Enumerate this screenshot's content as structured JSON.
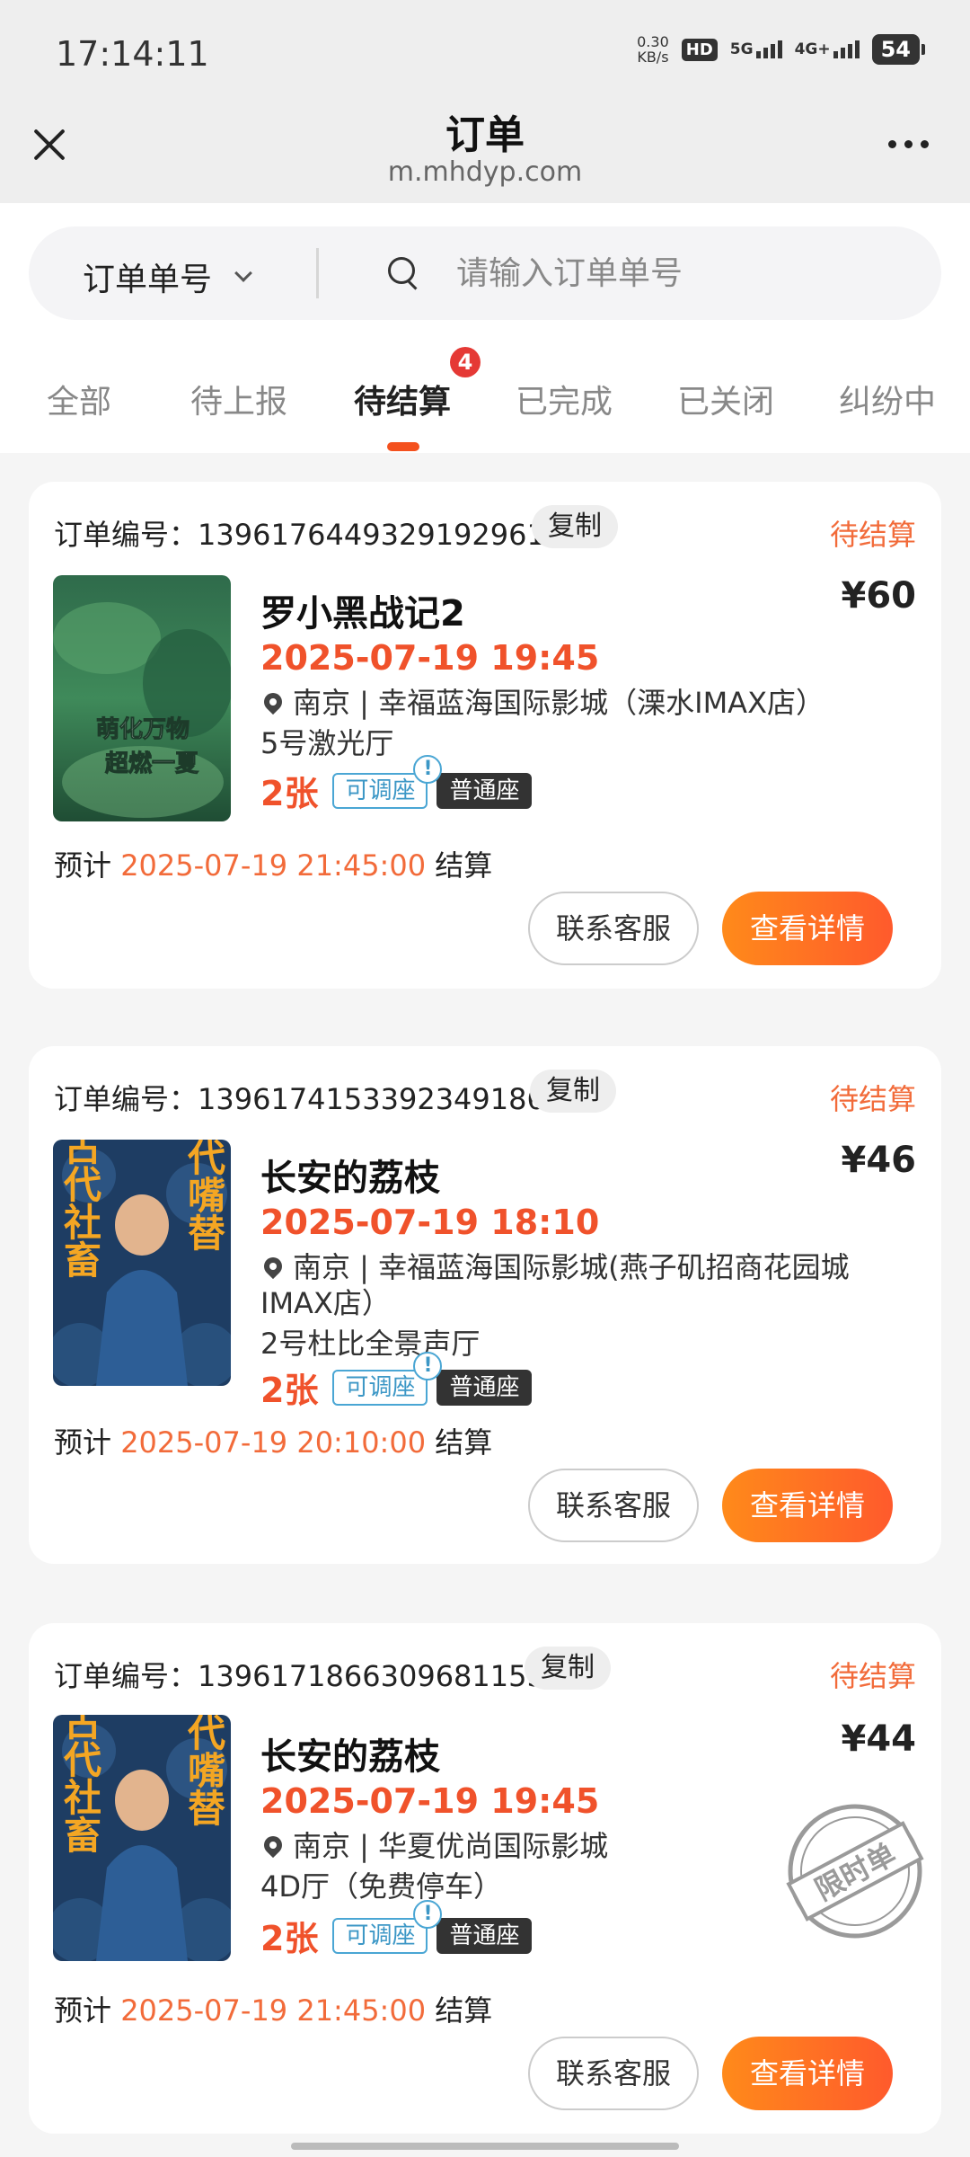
{
  "status_bar": {
    "time": "17:14:11",
    "net_speed_value": "0.30",
    "net_speed_unit": "KB/s",
    "hd_label": "HD",
    "sim1_label": "5G",
    "sim2_label": "4G+",
    "battery": "54"
  },
  "nav": {
    "title": "订单",
    "subtitle": "m.mhdyp.com",
    "close_icon": "close-icon",
    "more_icon": "more-icon"
  },
  "search": {
    "type_label": "订单单号",
    "placeholder": "请输入订单单号",
    "value": ""
  },
  "tabs": [
    {
      "label": "全部",
      "active": false
    },
    {
      "label": "待上报",
      "active": false
    },
    {
      "label": "待结算",
      "active": true,
      "badge": "4"
    },
    {
      "label": "已完成",
      "active": false
    },
    {
      "label": "已关闭",
      "active": false
    },
    {
      "label": "纠纷中",
      "active": false
    }
  ],
  "labels": {
    "order_prefix": "订单编号：",
    "copy": "复制",
    "adjustable": "可调座",
    "adjustable_mark": "!",
    "seat_type": "普通座",
    "settle_prefix": "预计",
    "settle_suffix": "结算",
    "contact_service": "联系客服",
    "view_detail": "查看详情"
  },
  "orders": [
    {
      "order_no": "1396176449329192961",
      "status": "待结算",
      "title": "罗小黑战记2",
      "price": "¥60",
      "showtime": "2025-07-19 19:45",
      "cinema": "南京 | 幸福蓝海国际影城（溧水IMAX店）",
      "hall": "5号激光厅",
      "tickets": "2张",
      "settle_time": "2025-07-19 21:45:00",
      "poster_text_1": "萌化万物",
      "poster_text_2": "超燃一夏"
    },
    {
      "order_no": "1396174153392349186",
      "status": "待结算",
      "title": "长安的荔枝",
      "price": "¥46",
      "showtime": "2025-07-19 18:10",
      "cinema": "南京 | 幸福蓝海国际影城(燕子矶招商花园城IMAX店）",
      "hall": "2号杜比全景声厅",
      "tickets": "2张",
      "settle_time": "2025-07-19 20:10:00",
      "poster_text_1": "古代社畜",
      "poster_text_2": "当代嘴替"
    },
    {
      "order_no": "1396171866309681153",
      "status": "待结算",
      "title": "长安的荔枝",
      "price": "¥44",
      "showtime": "2025-07-19 19:45",
      "cinema": "南京 | 华夏优尚国际影城",
      "hall": "4D厅（免费停车）",
      "tickets": "2张",
      "settle_time": "2025-07-19 21:45:00",
      "stamp": "限时单",
      "poster_text_1": "古代社畜",
      "poster_text_2": "当代嘴替"
    }
  ],
  "colors": {
    "accent": "#f0522b",
    "status": "#f26b3a",
    "tag_blue": "#3c97c6"
  }
}
